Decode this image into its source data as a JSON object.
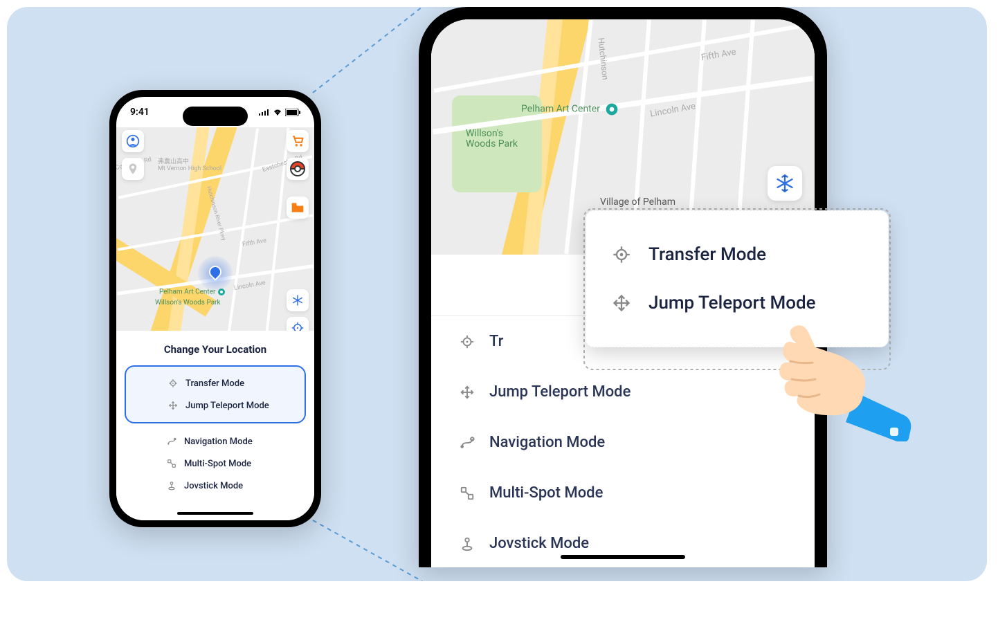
{
  "status": {
    "time": "9:41"
  },
  "map": {
    "poi1": "Pelham Art Center",
    "poi2": "Willson's Woods Park",
    "town": "Village of Pelham",
    "school_jp": "弗農山高中",
    "school_en": "Mt Vernon High School",
    "road1": "Lincoln Ave",
    "road2": "Fifth Ave",
    "road3": "Hutchinson",
    "road4": "Eastchester Rd",
    "road5": "Columbus Rd"
  },
  "panel": {
    "title": "Change Your Location",
    "title_partial": "Cha",
    "modes": {
      "transfer": "Transfer Mode",
      "jump": "Jump Teleport Mode",
      "navigation": "Navigation Mode",
      "multispot": "Multi-Spot Mode",
      "joystick": "Jovstick Mode"
    }
  },
  "popup": {
    "transfer": "Transfer Mode",
    "jump": "Jump Teleport Mode"
  }
}
